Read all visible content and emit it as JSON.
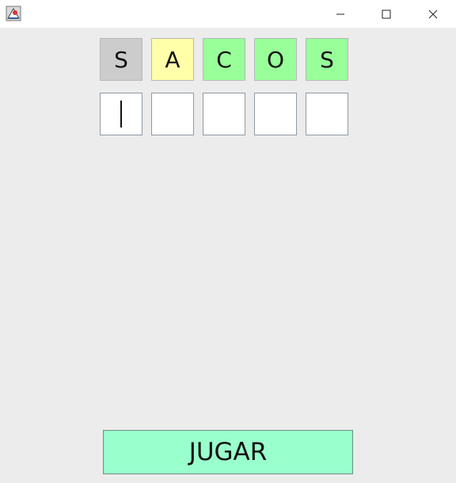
{
  "window": {
    "icon": "java-app-icon",
    "controls": {
      "minimize_icon": "minimize-icon",
      "maximize_icon": "maximize-icon",
      "close_icon": "close-icon"
    }
  },
  "game": {
    "guess_rows": [
      {
        "tiles": [
          {
            "letter": "S",
            "status": "absent",
            "color": "#cccccc"
          },
          {
            "letter": "A",
            "status": "present",
            "color": "#ffffaa"
          },
          {
            "letter": "C",
            "status": "correct",
            "color": "#99ff99"
          },
          {
            "letter": "O",
            "status": "correct",
            "color": "#99ff99"
          },
          {
            "letter": "S",
            "status": "correct",
            "color": "#99ff99"
          }
        ]
      }
    ],
    "input_row": {
      "values": [
        "",
        "",
        "",
        "",
        ""
      ],
      "focused_index": 0
    },
    "play_button": {
      "label": "JUGAR",
      "color": "#99ffcc"
    }
  }
}
